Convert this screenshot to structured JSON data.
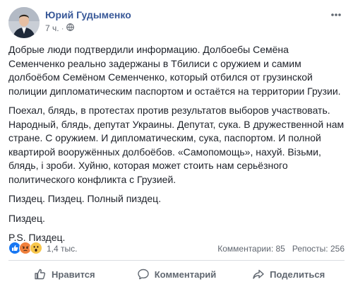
{
  "post": {
    "author": "Юрий Гудыменко",
    "time": "7 ч.",
    "dot": "·",
    "paragraphs": [
      "Добрые люди подтвердили информацию. Долбоебы Семёна Семенченко реально задержаны в Тбилиси с оружием и самим долбоёбом Семёном Семенченко, который отбился от грузинской полиции дипломатическим паспортом и остаётся на территории Грузии.",
      "Поехал, блядь, в протестах против результатов выборов участвовать. Народный, блядь, депутат Украины. Депутат, сука. В дружественной нам стране. С оружием. И дипломатическим, сука, паспортом. И полной квартирой вооружённых долбоёбов. «Самопомощь», нахуй. Візьми, блядь, і зроби. Хуйню, которая может стоить нам серьёзного политического конфликта с Грузией.",
      "Пиздец. Пиздец. Полный пиздец.",
      "Пиздец.",
      "P.S. Пиздец."
    ]
  },
  "reactions": {
    "count": "1,4 тыс.",
    "comments": "Комментарии: 85",
    "reposts": "Репосты: 256",
    "colors": {
      "like": "#1877f2",
      "angry": "#f0803c",
      "wow": "#f7c64b"
    }
  },
  "actions": {
    "like": "Нравится",
    "comment": "Комментарий",
    "share": "Поделиться"
  },
  "colors": {
    "author": "#385898",
    "text": "#1d2129",
    "meta": "#616770"
  }
}
